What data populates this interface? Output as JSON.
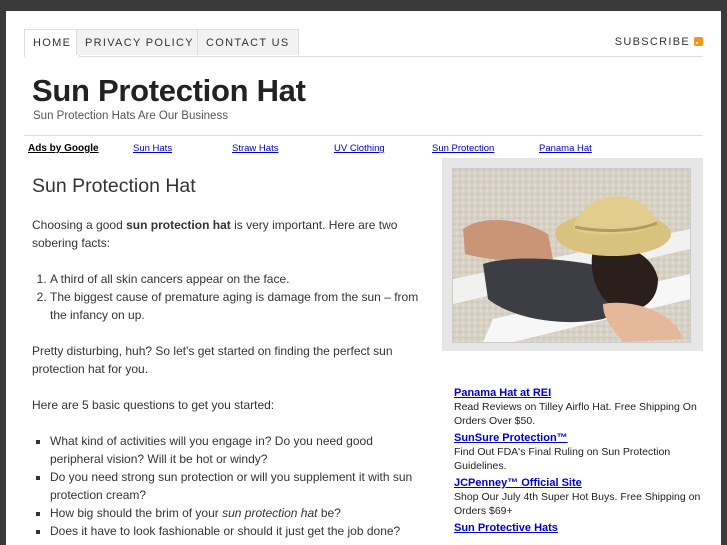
{
  "nav": {
    "tabs": [
      {
        "label": "HOME"
      },
      {
        "label": "PRIVACY POLICY"
      },
      {
        "label": "CONTACT US"
      }
    ],
    "subscribe": "SUBSCRIBE"
  },
  "header": {
    "title": "Sun Protection Hat",
    "tagline": "Sun Protection Hats Are Our Business"
  },
  "adsbar": {
    "ads_by": "Ads by Google",
    "links": [
      "Sun Hats",
      "Straw Hats",
      "UV Clothing",
      "Sun Protection",
      "Panama Hat"
    ]
  },
  "post": {
    "title": "Sun Protection Hat",
    "intro_a": "Choosing a good ",
    "intro_bold": "sun protection hat",
    "intro_b": " is very important. Here are two sobering facts:",
    "facts": [
      "A third of all skin cancers appear on the face.",
      "The biggest cause of premature aging is damage from the sun – from the infancy on up."
    ],
    "p2": "Pretty disturbing, huh? So let's get started on finding the perfect sun protection hat for you.",
    "p3": "Here are 5 basic questions to get you started:",
    "q1": "What kind of activities will you engage in? Do you need good peripheral vision? Will it be hot or windy?",
    "q2": "Do you need strong sun protection or will you supplement it with sun protection cream?",
    "q3_a": "How big should the brim of your ",
    "q3_em": "sun protection hat",
    "q3_b": " be?",
    "q4": "Does it have to look fashionable or should it just get the job done?"
  },
  "sidebar_ads": [
    {
      "title": "Panama Hat at REI",
      "body": "Read Reviews on Tilley Airflo Hat. Free Shipping On Orders Over $50."
    },
    {
      "title": "SunSure Protection™",
      "body": "Find Out FDA's Final Ruling on Sun Protection Guidelines."
    },
    {
      "title": "JCPenney™ Official Site",
      "body": "Shop Our July 4th Super Hot Buys. Free Shipping on Orders $69+"
    },
    {
      "title": "Sun Protective Hats",
      "body": ""
    }
  ],
  "colors": {
    "link": "#0000cc",
    "frame": "#3a3a3a",
    "rss": "#f7941d"
  }
}
